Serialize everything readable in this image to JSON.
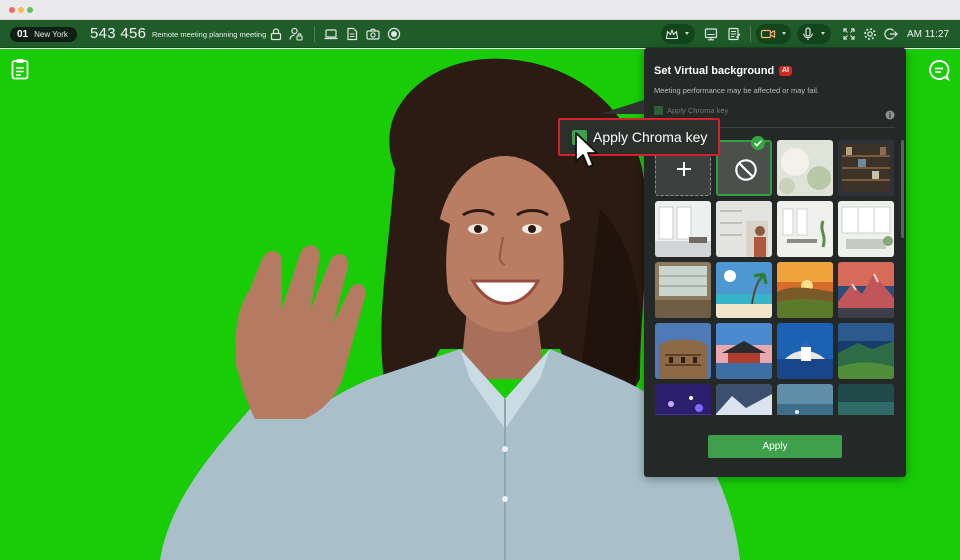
{
  "toolbar": {
    "room_number": "01",
    "room_city": "New York",
    "meeting_id": "543 456",
    "meeting_title": "Remote meeting planning meeting",
    "clock": "AM 11:27"
  },
  "panel": {
    "title": "Set Virtual background",
    "ai_badge": "AI",
    "subtitle": "Meeting performance may be affected or may fail.",
    "chroma_label": "Apply Chroma key",
    "apply_label": "Apply"
  },
  "callout": {
    "label": "Apply Chroma key"
  },
  "colors": {
    "toolbar": "#1f5c2a",
    "stage_green": "#18cc06",
    "panel_bg": "#242826",
    "accent": "#3ea04a",
    "highlight_red": "#d3222a"
  },
  "icons": {
    "toolbar": [
      "lock-icon",
      "user-lock-icon",
      "laptop-icon",
      "document-icon",
      "camera-icon",
      "record-icon",
      "crown-icon",
      "screen-icon",
      "notes-icon",
      "video-icon",
      "microphone-icon",
      "fullscreen-icon",
      "gear-icon",
      "exit-icon"
    ],
    "sidebar": [
      "clipboard-icon",
      "chat-icon"
    ],
    "panel": [
      "info-icon",
      "plus-icon",
      "ban-icon",
      "check-icon"
    ]
  }
}
